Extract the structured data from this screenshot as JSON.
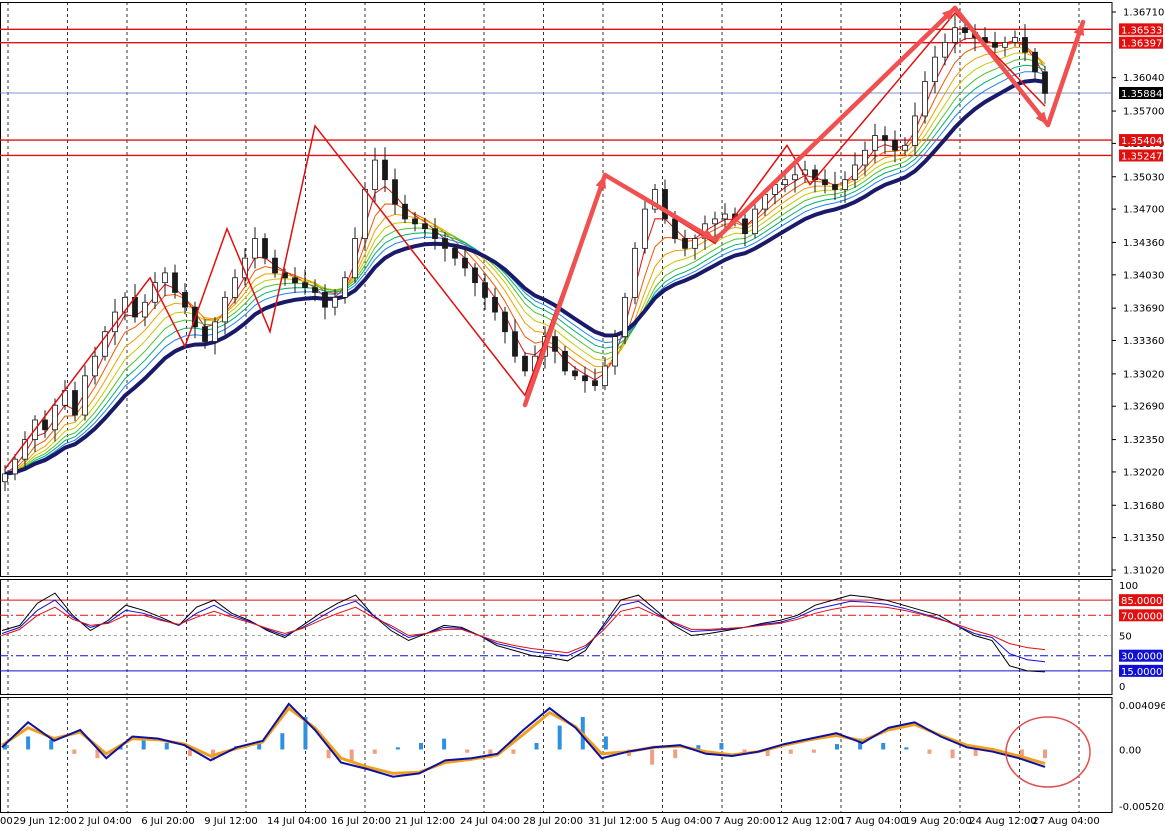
{
  "chart_data": [
    {
      "type": "line",
      "name": "price",
      "ylim": [
        1.3102,
        1.3671
      ],
      "price_ticks": [
        "1.36710",
        "1.36040",
        "1.35700",
        "1.35370",
        "1.35030",
        "1.34700",
        "1.34360",
        "1.34030",
        "1.33690",
        "1.33360",
        "1.33020",
        "1.32690",
        "1.32350",
        "1.32020",
        "1.31680",
        "1.31350",
        "1.31020"
      ],
      "price_tags": [
        {
          "label": "1.36533",
          "value": 1.36533,
          "color": "#e01010"
        },
        {
          "label": "1.36397",
          "value": 1.36397,
          "color": "#e01010"
        },
        {
          "label": "1.35884",
          "value": 1.35884,
          "color": "#000000"
        },
        {
          "label": "1.35404",
          "value": 1.35404,
          "color": "#e01010"
        },
        {
          "label": "1.35247",
          "value": 1.35247,
          "color": "#e01010"
        }
      ],
      "horizontal_levels": [
        1.36533,
        1.36397,
        1.35404,
        1.35247
      ],
      "current_price": 1.35884,
      "close": [
        1.32,
        1.3215,
        1.3235,
        1.3255,
        1.3245,
        1.327,
        1.3285,
        1.326,
        1.33,
        1.332,
        1.3345,
        1.3365,
        1.338,
        1.336,
        1.3375,
        1.3395,
        1.3405,
        1.3385,
        1.337,
        1.335,
        1.3335,
        1.3355,
        1.338,
        1.34,
        1.342,
        1.344,
        1.342,
        1.3405,
        1.34,
        1.3395,
        1.339,
        1.3385,
        1.337,
        1.338,
        1.34,
        1.344,
        1.349,
        1.352,
        1.35,
        1.3475,
        1.346,
        1.3455,
        1.345,
        1.344,
        1.343,
        1.342,
        1.341,
        1.3395,
        1.338,
        1.3365,
        1.3345,
        1.332,
        1.3305,
        1.332,
        1.334,
        1.3325,
        1.3305,
        1.33,
        1.3295,
        1.329,
        1.331,
        1.334,
        1.338,
        1.343,
        1.347,
        1.349,
        1.346,
        1.344,
        1.343,
        1.344,
        1.3455,
        1.346,
        1.3465,
        1.346,
        1.3445,
        1.347,
        1.3485,
        1.3495,
        1.35,
        1.3505,
        1.351,
        1.35,
        1.3495,
        1.349,
        1.35,
        1.3515,
        1.353,
        1.3545,
        1.354,
        1.353,
        1.3535,
        1.3565,
        1.36,
        1.3625,
        1.364,
        1.3655,
        1.365,
        1.3645,
        1.364,
        1.3635,
        1.364,
        1.3645,
        1.363,
        1.361,
        1.3588
      ],
      "peaks_troughs_zigzag": [
        1.3205,
        1.34,
        1.333,
        1.345,
        1.3345,
        1.3555,
        1.328,
        1.3505,
        1.3435,
        1.3535,
        1.3495,
        1.367,
        1.3575
      ],
      "arrow_projection": {
        "from": 1.356,
        "to": 1.367
      },
      "x_labels": [
        "29 Jun 12:00",
        "2 Jul 04:00",
        "6 Jul 20:00",
        "9 Jul 12:00",
        "14 Jul 04:00",
        "16 Jul 20:00",
        "21 Jul 12:00",
        "24 Jul 04:00",
        "28 Jul 20:00",
        "31 Jul 12:00",
        "5 Aug 04:00",
        "7 Aug 20:00",
        "12 Aug 12:00",
        "17 Aug 04:00",
        "19 Aug 20:00",
        "24 Aug 12:00",
        "27 Aug 04:00"
      ],
      "x_label_partial_left": "00"
    },
    {
      "type": "line",
      "name": "oscillator",
      "ylim": [
        0,
        100
      ],
      "ticks": [
        "100",
        "50",
        "0"
      ],
      "levels": [
        {
          "label": "85.0000",
          "value": 85,
          "color": "#e01010",
          "style": "solid"
        },
        {
          "label": "70.0000",
          "value": 70,
          "color": "#e01010",
          "style": "dashdot"
        },
        {
          "label": "30.0000",
          "value": 30,
          "color": "#1010d0",
          "style": "dashdot"
        },
        {
          "label": "15.0000",
          "value": 15,
          "color": "#1010d0",
          "style": "solid"
        }
      ],
      "lines": [
        {
          "color": "#000000",
          "values": [
            55,
            60,
            82,
            92,
            70,
            55,
            65,
            80,
            75,
            68,
            60,
            78,
            85,
            72,
            65,
            55,
            48,
            60,
            72,
            82,
            90,
            70,
            55,
            45,
            52,
            60,
            58,
            50,
            40,
            35,
            30,
            28,
            25,
            35,
            60,
            85,
            90,
            75,
            60,
            50,
            52,
            55,
            58,
            62,
            65,
            70,
            80,
            85,
            90,
            88,
            85,
            80,
            75,
            70,
            60,
            50,
            45,
            20,
            15,
            14
          ]
        },
        {
          "color": "#1010d0",
          "values": [
            52,
            58,
            75,
            85,
            68,
            58,
            63,
            75,
            72,
            66,
            60,
            72,
            80,
            70,
            64,
            56,
            50,
            58,
            68,
            78,
            84,
            70,
            58,
            48,
            52,
            58,
            57,
            50,
            42,
            38,
            34,
            32,
            30,
            38,
            58,
            80,
            84,
            72,
            62,
            54,
            55,
            56,
            58,
            61,
            63,
            68,
            76,
            80,
            84,
            83,
            81,
            77,
            72,
            67,
            60,
            52,
            48,
            32,
            26,
            24
          ]
        },
        {
          "color": "#e01010",
          "values": [
            50,
            56,
            70,
            78,
            66,
            60,
            62,
            70,
            70,
            65,
            61,
            68,
            74,
            68,
            63,
            57,
            52,
            57,
            65,
            72,
            78,
            68,
            60,
            50,
            52,
            56,
            56,
            50,
            44,
            40,
            37,
            35,
            33,
            40,
            55,
            74,
            78,
            70,
            63,
            56,
            56,
            57,
            58,
            60,
            62,
            66,
            72,
            76,
            79,
            79,
            78,
            75,
            71,
            66,
            61,
            55,
            50,
            42,
            38,
            36
          ]
        }
      ]
    },
    {
      "type": "bar",
      "name": "macd",
      "ylim": [
        -0.005202,
        0.0040965
      ],
      "ticks": [
        "0.0040965",
        "0.00",
        "-0.005202"
      ],
      "histogram": [
        0.0006,
        0.0012,
        0.0009,
        -0.0004,
        -0.0008,
        0.0004,
        0.001,
        0.0006,
        -0.0006,
        -0.001,
        0.0003,
        0.0008,
        0.0015,
        0.003,
        -0.0008,
        -0.0012,
        -0.0004,
        0.0002,
        0.0006,
        0.001,
        -0.0003,
        -0.0008,
        -0.0004,
        0.0006,
        0.0022,
        0.003,
        0.0012,
        -0.0006,
        -0.0014,
        -0.0008,
        0.0004,
        0.0006,
        -0.0003,
        -0.0006,
        -0.0004,
        -0.0003,
        0.0005,
        0.001,
        0.0006,
        0.0002,
        -0.0004,
        -0.0008,
        -0.0006,
        -0.0004,
        -0.0006,
        -0.0008
      ],
      "macd_line": [
        0.0002,
        0.0025,
        0.0008,
        0.0018,
        -0.0008,
        0.0012,
        0.001,
        0.0004,
        -0.001,
        0.0002,
        0.0008,
        0.0042,
        0.0018,
        -0.0012,
        -0.0018,
        -0.0025,
        -0.0022,
        -0.001,
        -0.0008,
        -0.0004,
        0.0018,
        0.0038,
        0.002,
        -0.0008,
        -0.0002,
        0.0002,
        0.0004,
        -0.0004,
        -0.0006,
        -0.0002,
        0.0005,
        0.001,
        0.0015,
        0.0006,
        0.002,
        0.0025,
        0.0012,
        0.0002,
        -0.0002,
        -0.0008,
        -0.0016
      ],
      "signal_line": [
        0.0004,
        0.002,
        0.001,
        0.0016,
        -0.0004,
        0.001,
        0.0009,
        0.0005,
        -0.0006,
        0.0001,
        0.0007,
        0.0038,
        0.002,
        -0.0008,
        -0.0016,
        -0.0022,
        -0.0021,
        -0.0012,
        -0.0009,
        -0.0005,
        0.0014,
        0.0034,
        0.0021,
        -0.0004,
        -0.0002,
        0.0002,
        0.0003,
        -0.0002,
        -0.0005,
        -0.0002,
        0.0004,
        0.0009,
        0.0013,
        0.0008,
        0.0018,
        0.0023,
        0.0013,
        0.0004,
        0.0,
        -0.0006,
        -0.0013
      ],
      "highlight_circle": true
    }
  ],
  "colors": {
    "bull_candle": "#1a1a1a",
    "ribbon": [
      "#e01010",
      "#f05a00",
      "#f0a000",
      "#c8c800",
      "#50c030",
      "#00b070",
      "#2080f0"
    ],
    "trend_ma": "#1a1a6a",
    "zigzag": "#e01010",
    "arrow": "#f05050",
    "grid": "#000000",
    "histogram_pos": "#3090e0",
    "histogram_neg": "#f0a080",
    "macd_line": "#1010a0",
    "signal_line": "#f0a020",
    "circle": "#e05050"
  }
}
